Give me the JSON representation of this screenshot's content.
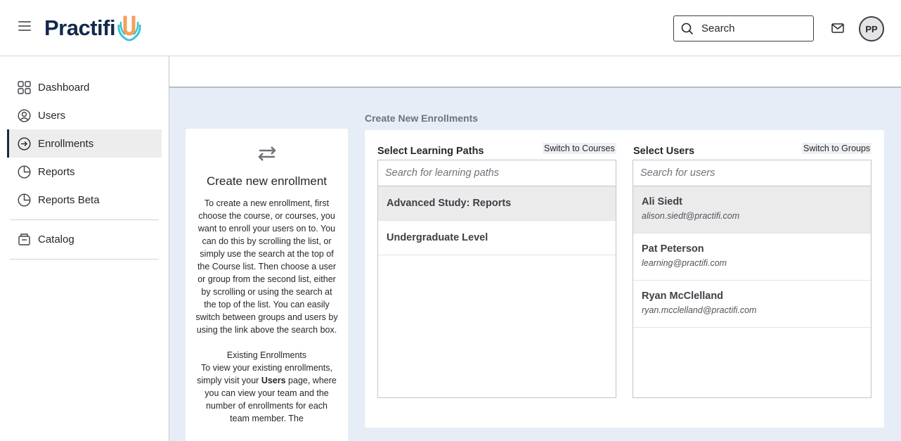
{
  "header": {
    "logo_text": "Practifi",
    "logo_letter": "U",
    "search_label": "Search",
    "avatar_initials": "PP"
  },
  "sidebar": {
    "items": [
      {
        "label": "Dashboard",
        "icon": "grid-icon"
      },
      {
        "label": "Users",
        "icon": "user-icon"
      },
      {
        "label": "Enrollments",
        "icon": "enroll-icon",
        "active": true
      },
      {
        "label": "Reports",
        "icon": "pie-chart-icon"
      },
      {
        "label": "Reports Beta",
        "icon": "pie-chart-icon"
      },
      {
        "label": "Catalog",
        "icon": "catalog-icon"
      }
    ]
  },
  "info": {
    "title": "Create new enrollment",
    "body": "To create a new enrollment, first choose the course, or courses, you want to enroll your users on to. You can do this by scrolling the list, or simply use the search at the top of the Course list. Then choose a user or group from the second list, either by scrolling or using the search at the top of the list. You can easily switch between groups and users by using the link above the search box.",
    "existing_title": "Existing Enrollments",
    "existing_prefix": "To view your existing enrollments, simply visit your ",
    "existing_bold": "Users",
    "existing_suffix": " page, where you can view your team and the number of enrollments for each team member. The"
  },
  "main": {
    "section_title": "Create New Enrollments",
    "paths": {
      "title": "Select Learning Paths",
      "switch_label": "Switch to Courses",
      "search_placeholder": "Search for learning paths",
      "items": [
        "Advanced Study: Reports",
        "Undergraduate Level"
      ]
    },
    "users": {
      "title": "Select Users",
      "switch_label": "Switch to Groups",
      "search_placeholder": "Search for users",
      "items": [
        {
          "name": "Ali Siedt",
          "email": "alison.siedt@practifi.com"
        },
        {
          "name": "Pat Peterson",
          "email": "learning@practifi.com"
        },
        {
          "name": "Ryan McClelland",
          "email": "ryan.mcclelland@practifi.com"
        }
      ]
    }
  },
  "colors": {
    "brand_navy": "#13294b",
    "brand_teal": "#3ec1d3",
    "brand_orange": "#f5a05a",
    "content_bg": "#e6edf7"
  }
}
